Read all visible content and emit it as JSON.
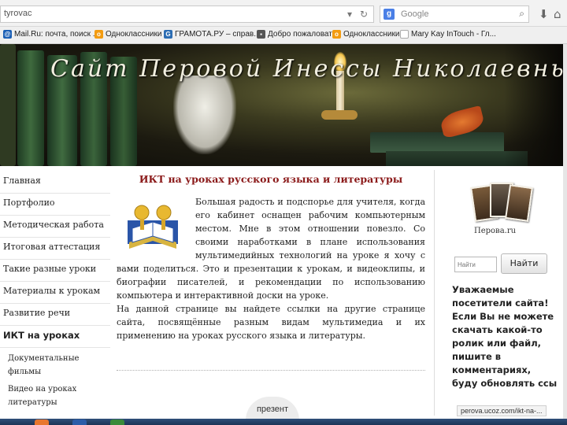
{
  "browser": {
    "url": "tyrovac",
    "search_engine": "Google",
    "search_placeholder": "Google",
    "bookmarks": [
      {
        "label": "Mail.Ru: почта, поиск ...",
        "color": "#1b5fb5",
        "glyph": "@"
      },
      {
        "label": "Одноклассники",
        "color": "#f39c12",
        "glyph": "o"
      },
      {
        "label": "ГРАМОТА.РУ – справ...",
        "color": "#2c6db3",
        "glyph": "G"
      },
      {
        "label": "Добро пожаловать",
        "color": "#555555",
        "glyph": "▪"
      },
      {
        "label": "Одноклассники",
        "color": "#f39c12",
        "glyph": "o"
      },
      {
        "label": "Mary Kay InTouch - Гл...",
        "color": "#bbbbbb",
        "glyph": ""
      }
    ]
  },
  "banner": {
    "title": "Сайт Перовой Инессы Николаевны"
  },
  "nav": {
    "items": [
      {
        "label": "Главная"
      },
      {
        "label": "Портфолио"
      },
      {
        "label": "Методическая работа"
      },
      {
        "label": "Итоговая аттестация"
      },
      {
        "label": "Такие разные уроки"
      },
      {
        "label": "Материалы к урокам"
      },
      {
        "label": "Развитие речи"
      }
    ],
    "active": "ИКТ на уроках",
    "sub_items": [
      {
        "label": "Документальные фильмы"
      },
      {
        "label": "Видео на уроках литературы"
      }
    ]
  },
  "main": {
    "title": "ИКТ на уроках русского языка и литературы",
    "paragraph1": "Большая радость и подспорье для учителя, когда его кабинет оснащен рабочим компьютерным местом. Мне в этом отношении повезло. Со своими наработками в плане использования мультимедийных технологий на уроке я хочу с вами поделиться. Это и презентации к урокам, и видеоклипы, и биографии писателей, и рекомендации по использованию компьютера и интерактивной доски на уроке.",
    "paragraph2": "На данной странице вы найдете ссылки на другие странице сайта, посвящённые разным видам мультимедиа и их применению на уроках русского языка и литературы.",
    "present_button": "презент"
  },
  "right": {
    "site_name": "Перова.ru",
    "search_placeholder": "Найти",
    "search_button": "Найти",
    "welcome_text": "Уважаемые посетители сайта! Если Вы не можете скачать какой-то ролик или файл, пишите в комментариях, буду обновлять ссы"
  },
  "status": {
    "hover_url": "perova.ucoz.com/ikt-na-..."
  },
  "taskbar": {
    "icons": [
      {
        "name": "firefox-icon",
        "color": "#e8772e"
      },
      {
        "name": "word-icon",
        "color": "#2b5ca8"
      },
      {
        "name": "app-icon",
        "color": "#3a8a3a"
      }
    ]
  }
}
